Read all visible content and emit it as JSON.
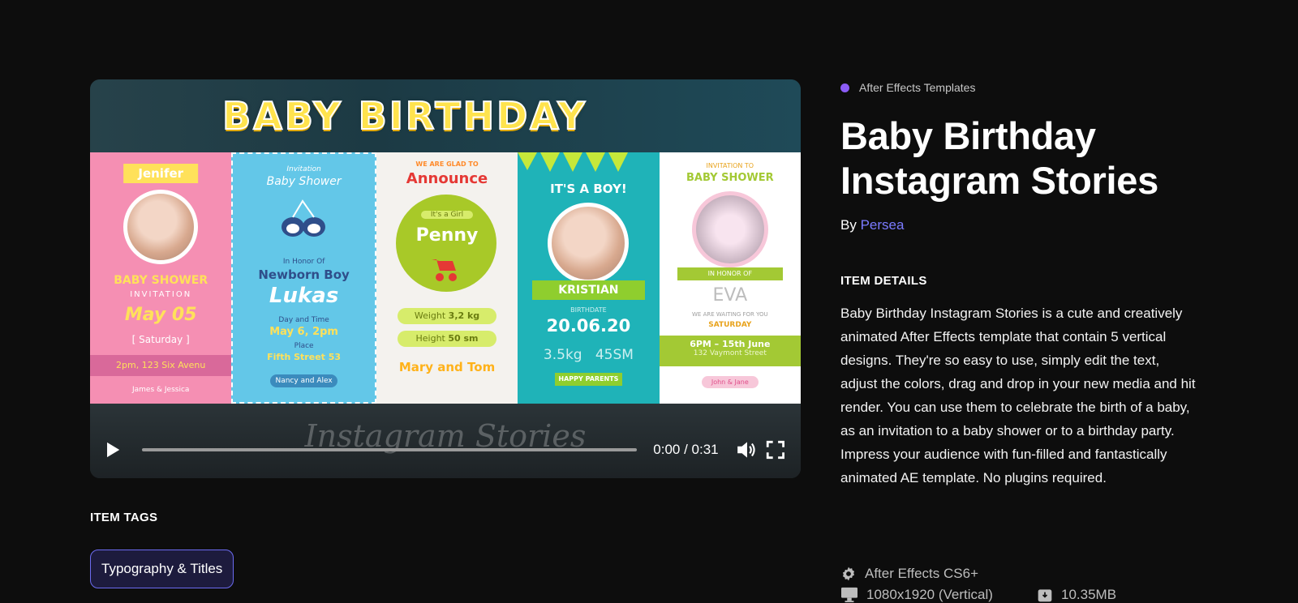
{
  "player": {
    "banner_title": "BABY BIRTHDAY",
    "watermark": "Instagram Stories",
    "time": "0:00 / 0:31",
    "cards": [
      {
        "ribbon": "Jenifer",
        "title": "BABY SHOWER",
        "subtitle": "INVITATION",
        "date": "May 05",
        "day": "[ Saturday ]",
        "address": "2pm, 123 Six Avenu",
        "names": "James & Jessica"
      },
      {
        "top": "Invitation",
        "title": "Baby Shower",
        "sub": "In Honor Of",
        "boy": "Newborn Boy",
        "name": "Lukas",
        "when_label": "Day and Time",
        "when": "May 6, 2pm",
        "place_label": "Place",
        "place": "Fifth Street 53",
        "names": "Nancy and Alex"
      },
      {
        "top": "WE ARE GLAD TO",
        "title": "Announce",
        "girl": "It's a Girl",
        "name": "Penny",
        "weight_label": "Weight",
        "weight": "3,2 kg",
        "height_label": "Height",
        "height": "50 sm",
        "parents": "Mary and Tom"
      },
      {
        "title": "IT'S A BOY!",
        "ribbon": "KRISTIAN",
        "born_label": "BIRTHDATE",
        "date": "20.06.20",
        "weight": "3.5kg",
        "height": "45SM",
        "badge": "HAPPY PARENTS"
      },
      {
        "top": "INVITATION TO",
        "title": "BABY SHOWER",
        "honor": "IN HONOR OF",
        "name": "EVA",
        "waiting": "WE ARE WAITING FOR YOU",
        "day": "SATURDAY",
        "when": "6PM – 15th June",
        "address": "132 Vaymont Street",
        "names": "John & Jane"
      }
    ]
  },
  "tags": {
    "heading": "ITEM TAGS",
    "items": [
      "Typography & Titles"
    ]
  },
  "item": {
    "category": "After Effects Templates",
    "title": "Baby Birthday Instagram Stories",
    "by": "By",
    "author": "Persea",
    "details_heading": "ITEM DETAILS",
    "description": "Baby Birthday Instagram Stories is a cute and creatively animated After Effects template that contain 5 vertical designs. They're so easy to use, simply edit the text, adjust the colors, drag and drop in your new media and hit render. You can use them to celebrate the birth of a baby, as an invitation to a baby shower or to a birthday party. Impress your audience with fun-filled and fantastically animated AE template. No plugins required.",
    "software": "After Effects CS6+",
    "resolution": "1080x1920 (Vertical)",
    "filesize": "10.35MB"
  },
  "colors": {
    "background": "#0d0d0d",
    "accent": "#7b7bff",
    "category_dot": "#8b5cf6",
    "tag_border": "#6b6bf0"
  },
  "icons": [
    "play-icon",
    "volume-icon",
    "fullscreen-icon",
    "gear-icon",
    "monitor-icon",
    "file-size-icon"
  ]
}
